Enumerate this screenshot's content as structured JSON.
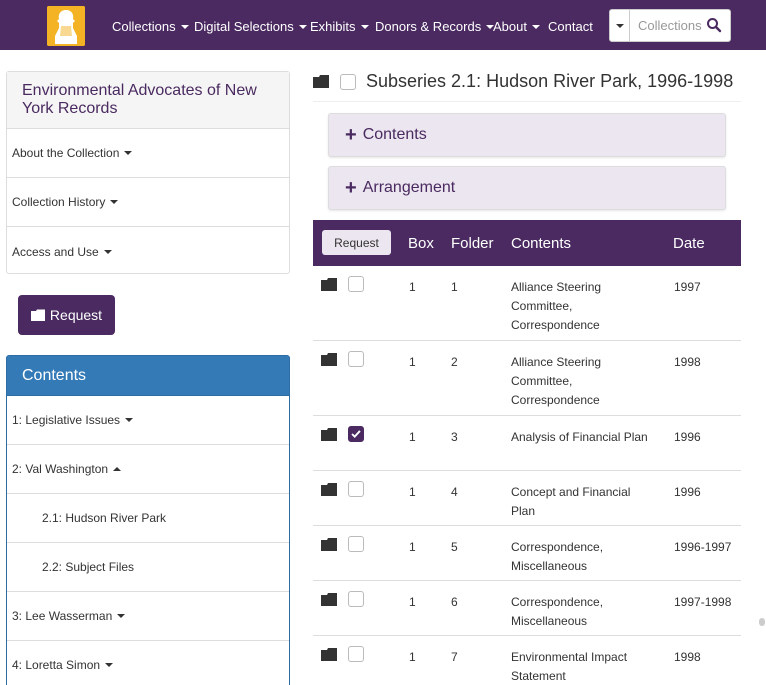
{
  "nav": {
    "logo_icon": "university-seal-logo",
    "items": [
      "Collections",
      "Digital Selections",
      "Exhibits",
      "Donors & Records",
      "About",
      "Contact"
    ],
    "search_placeholder": "Collections"
  },
  "sidebar": {
    "collection_title": "Environmental Advocates of New York Records",
    "items": [
      "About the Collection",
      "Collection History",
      "Access and Use"
    ],
    "request_label": "Request",
    "contents_heading": "Contents",
    "contents_items": [
      "1: Legislative Issues",
      "2: Val Washington",
      "2.1: Hudson River Park",
      "2.2: Subject Files",
      "3: Lee Wasserman",
      "4: Loretta Simon"
    ]
  },
  "main": {
    "title": "Subseries 2.1: Hudson River Park, 1996-1998",
    "accordions": [
      "Contents",
      "Arrangement"
    ],
    "table": {
      "request_label": "Request",
      "headers": [
        "Box",
        "Folder",
        "Contents",
        "Date"
      ],
      "rows": [
        {
          "box": "1",
          "folder": "1",
          "contents": "Alliance Steering Committee, Correspondence",
          "date": "1997",
          "checked": false
        },
        {
          "box": "1",
          "folder": "2",
          "contents": "Alliance Steering Committee, Correspondence",
          "date": "1998",
          "checked": false
        },
        {
          "box": "1",
          "folder": "3",
          "contents": "Analysis of Financial Plan",
          "date": "1996",
          "checked": true
        },
        {
          "box": "1",
          "folder": "4",
          "contents": "Concept and Financial Plan",
          "date": "1996",
          "checked": false
        },
        {
          "box": "1",
          "folder": "5",
          "contents": "Correspondence, Miscellaneous",
          "date": "1996-1997",
          "checked": false
        },
        {
          "box": "1",
          "folder": "6",
          "contents": "Correspondence, Miscellaneous",
          "date": "1997-1998",
          "checked": false
        },
        {
          "box": "1",
          "folder": "7",
          "contents": "Environmental Impact Statement",
          "date": "1998",
          "checked": false
        }
      ]
    }
  },
  "colors": {
    "brand_purple": "#4a2a60",
    "accent_blue": "#337ab7",
    "accordion_bg": "#ebe6ef",
    "logo_gold": "#f4b324"
  }
}
